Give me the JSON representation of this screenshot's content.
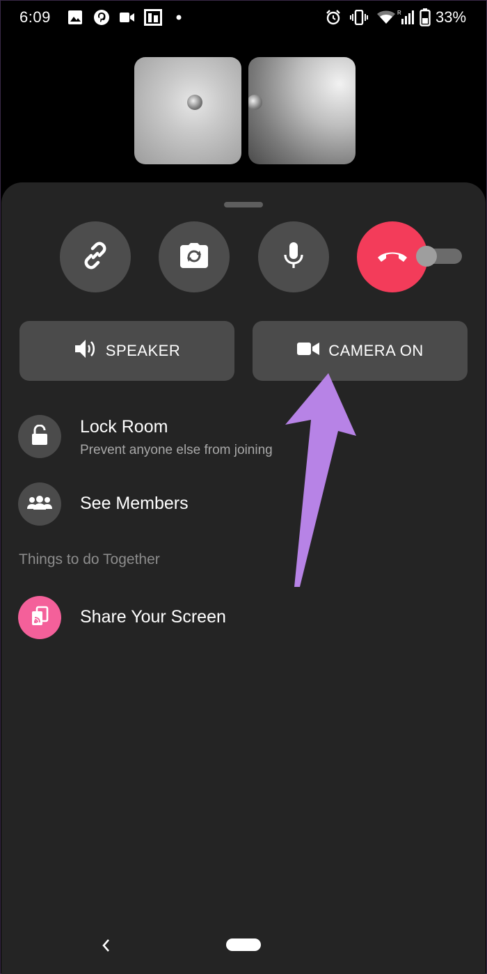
{
  "status_bar": {
    "time": "6:09",
    "battery": "33%",
    "left_icons": [
      "gallery-icon",
      "pinterest-icon",
      "video-icon",
      "photo-icon",
      "dot-icon"
    ],
    "right_icons": [
      "alarm-icon",
      "vibrate-icon",
      "wifi-icon",
      "signal-icon",
      "battery-icon"
    ]
  },
  "call_controls": {
    "buttons": [
      {
        "name": "copy-link-button",
        "icon": "link-icon"
      },
      {
        "name": "flip-camera-button",
        "icon": "flip-camera-icon"
      },
      {
        "name": "mute-button",
        "icon": "microphone-icon"
      },
      {
        "name": "end-call-button",
        "icon": "hang-up-icon"
      }
    ],
    "speaker_label": "SPEAKER",
    "camera_label": "CAMERA ON"
  },
  "options": {
    "lock_room": {
      "title": "Lock Room",
      "subtitle": "Prevent anyone else from joining",
      "toggle_on": false
    },
    "see_members": {
      "title": "See Members"
    },
    "section_header": "Things to do Together",
    "share_screen": {
      "title": "Share Your Screen"
    }
  },
  "colors": {
    "sheet_background": "#242424",
    "button_background": "#4b4b4b",
    "end_call": "#f33c5a",
    "share_screen_icon": "#f4609a",
    "annotation_arrow": "#b783e6"
  },
  "navigation": {
    "icons": [
      "back-icon",
      "home-pill-icon"
    ]
  }
}
